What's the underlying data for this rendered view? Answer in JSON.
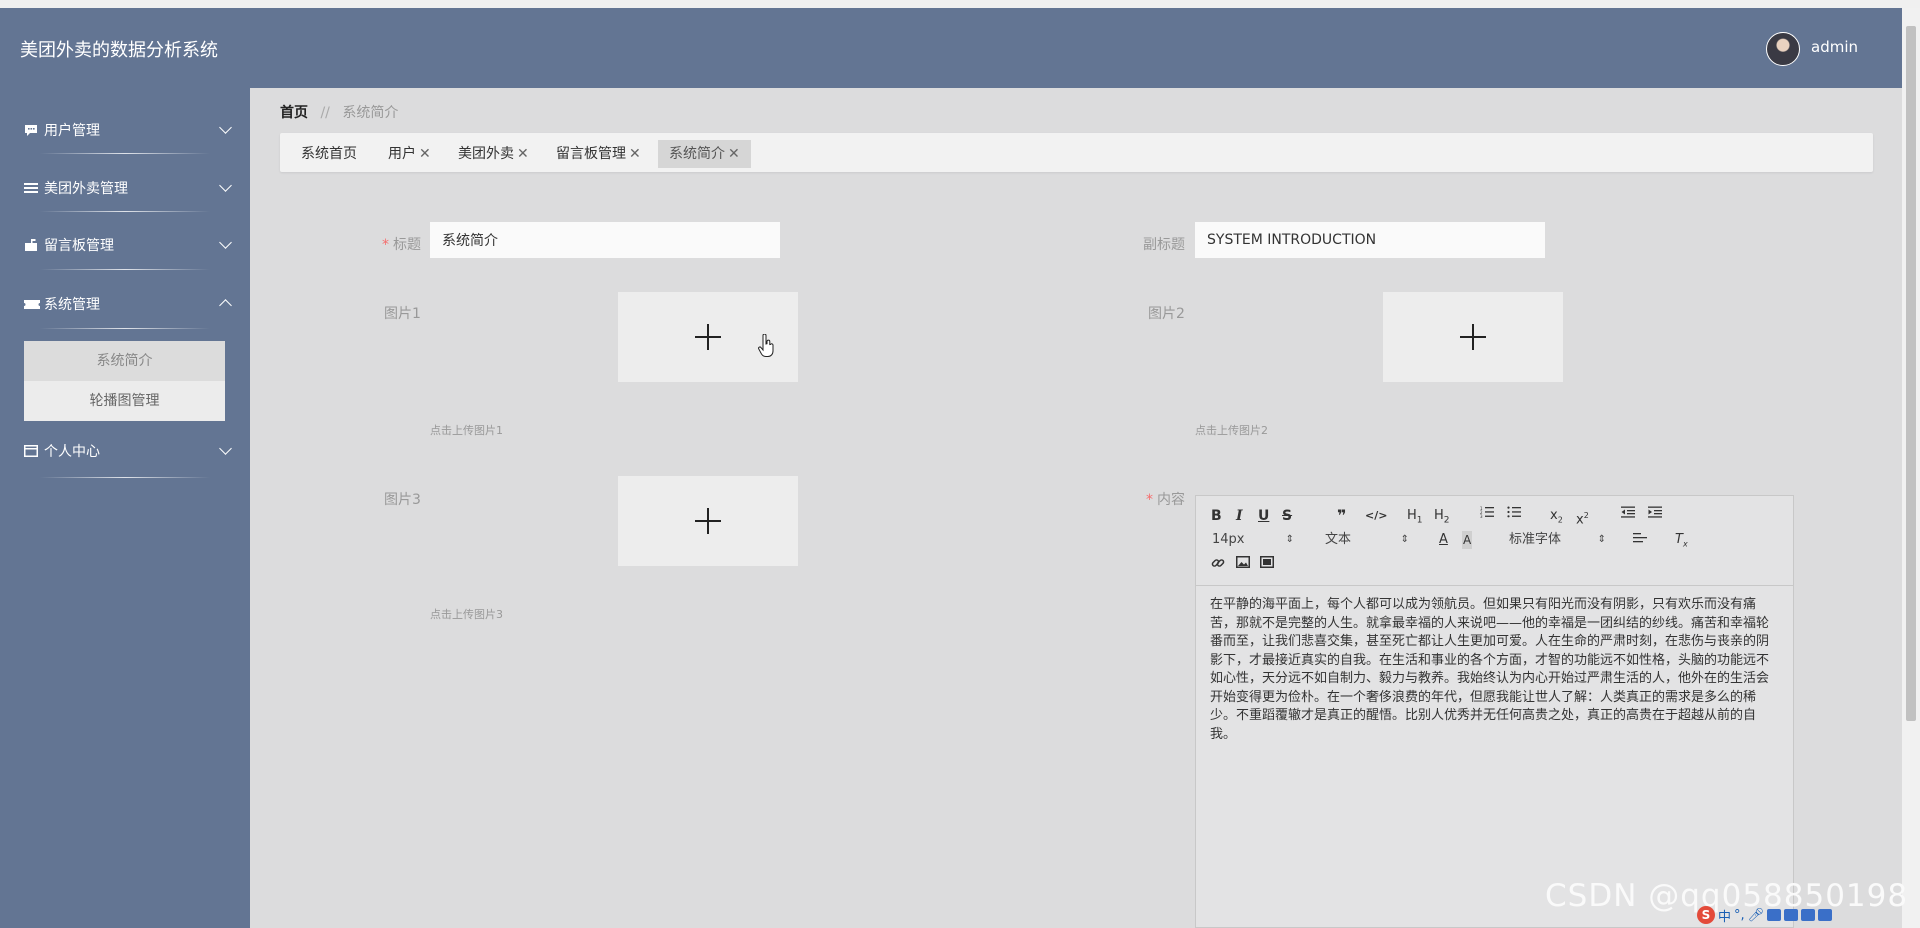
{
  "header": {
    "app_title": "美团外卖的数据分析系统",
    "username": "admin"
  },
  "sidebar": {
    "items": [
      {
        "label": "用户管理",
        "icon": "chat-icon",
        "expanded": false
      },
      {
        "label": "美团外卖管理",
        "icon": "list-icon",
        "expanded": false
      },
      {
        "label": "留言板管理",
        "icon": "mailbox-icon",
        "expanded": false
      },
      {
        "label": "系统管理",
        "icon": "ticket-icon",
        "expanded": true,
        "children": [
          {
            "label": "系统简介",
            "active": true
          },
          {
            "label": "轮播图管理",
            "active": false
          }
        ]
      },
      {
        "label": "个人中心",
        "icon": "card-icon",
        "expanded": false
      }
    ]
  },
  "breadcrumb": {
    "home": "首页",
    "separator": "//",
    "current": "系统简介"
  },
  "tabs": [
    {
      "label": "系统首页",
      "closable": false
    },
    {
      "label": "用户",
      "closable": true
    },
    {
      "label": "美团外卖",
      "closable": true
    },
    {
      "label": "留言板管理",
      "closable": true
    },
    {
      "label": "系统简介",
      "closable": true,
      "active": true
    }
  ],
  "form": {
    "title": {
      "label": "标题",
      "required": true,
      "value": "系统简介"
    },
    "subtitle": {
      "label": "副标题",
      "required": false,
      "value": "SYSTEM INTRODUCTION"
    },
    "pic1": {
      "label": "图片1",
      "hint": "点击上传图片1"
    },
    "pic2": {
      "label": "图片2",
      "hint": "点击上传图片2"
    },
    "pic3": {
      "label": "图片3",
      "hint": "点击上传图片3"
    },
    "content": {
      "label": "内容",
      "required": true,
      "toolbar": {
        "font_size": "14px",
        "header_select": "文本",
        "font_family": "标准字体"
      },
      "lines": [
        "在平静的海平面上，每个人都可以成为领航员。但如果只有阳光而没有阴影，只有欢乐而没有痛",
        "苦，那就不是完整的人生。就拿最幸福的人来说吧——他的幸福是一团纠结的纱线。痛苦和幸福轮",
        "番而至，让我们悲喜交集，甚至死亡都让人生更加可爱。人在生命的严肃时刻，在悲伤与丧亲的阴",
        "影下，才最接近真实的自我。在生活和事业的各个方面，才智的功能远不如性格，头脑的功能远不",
        "如心性，天分远不如自制力、毅力与教养。我始终认为内心开始过严肃生活的人，他外在的生活会",
        "开始变得更为俭朴。在一个奢侈浪费的年代，但愿我能让世人了解：人类真正的需求是多么的稀",
        "少。不重蹈覆辙才是真正的醒悟。比别人优秀并无任何高贵之处，真正的高贵在于超越从前的自",
        "我。"
      ]
    }
  },
  "watermark": "CSDN @qq058850198",
  "ime": {
    "logo": "S",
    "lang": "中"
  }
}
